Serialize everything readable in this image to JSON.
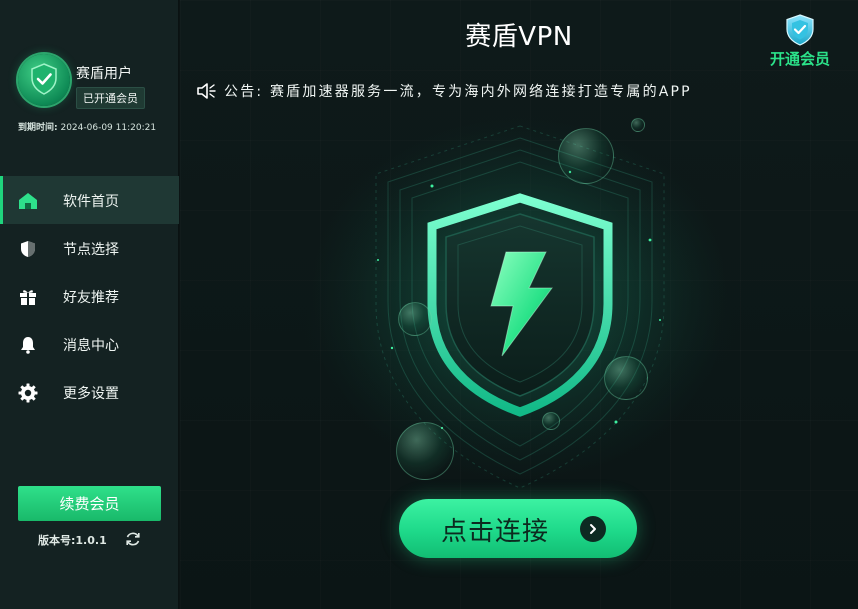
{
  "sidebar": {
    "username": "赛盾用户",
    "member_badge": "已开通会员",
    "expiry_label": "到期时间:",
    "expiry_value": "2024-06-09 11:20:21",
    "nav": [
      {
        "label": "软件首页",
        "icon": "home-icon",
        "active": true
      },
      {
        "label": "节点选择",
        "icon": "shield-icon",
        "active": false
      },
      {
        "label": "好友推荐",
        "icon": "gift-icon",
        "active": false
      },
      {
        "label": "消息中心",
        "icon": "bell-icon",
        "active": false
      },
      {
        "label": "更多设置",
        "icon": "gear-icon",
        "active": false
      }
    ],
    "renew_label": "续费会员",
    "version_text": "版本号:1.0.1"
  },
  "header": {
    "title": "赛盾VPN",
    "vip_label": "开通会员"
  },
  "notice": {
    "icon": "speaker-icon",
    "text": "公告:  赛盾加速器服务一流，专为海内外网络连接打造专属的APP"
  },
  "connect": {
    "label": "点击连接",
    "icon": "arrow-right-icon"
  },
  "colors": {
    "accent": "#1fd57d",
    "sidebar_bg": "#142222",
    "main_bg": "#0e1a1a"
  }
}
